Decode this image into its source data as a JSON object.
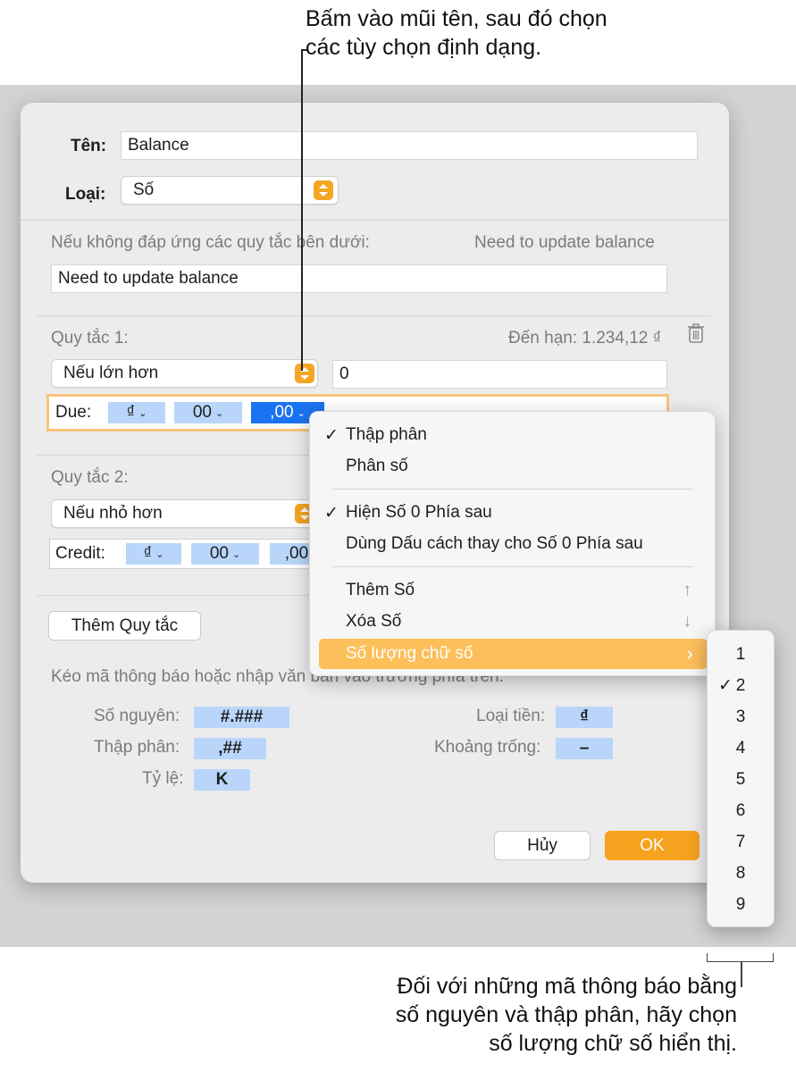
{
  "callouts": {
    "top_line1": "Bấm vào mũi tên, sau đó chọn",
    "top_line2": "các tùy chọn định dạng.",
    "bottom_line1": "Đối với những mã thông báo bằng",
    "bottom_line2": "số nguyên và thập phân, hãy chọn",
    "bottom_line3": "số lượng chữ số hiển thị."
  },
  "dialog": {
    "name_label": "Tên:",
    "name_value": "Balance",
    "type_label": "Loại:",
    "type_value": "Số",
    "fallback_label": "Nếu không đáp ứng các quy tắc bên dưới:",
    "fallback_preview": "Need to update balance",
    "fallback_value": "Need to update balance",
    "rule1": {
      "title": "Quy tắc 1:",
      "preview": "Đến hạn: 1.234,12 ₫",
      "condition": "Nếu lớn hơn",
      "value": "0",
      "format_prefix": "Due:",
      "tokens": [
        "₫",
        "00",
        ",00"
      ]
    },
    "rule2": {
      "title": "Quy tắc 2:",
      "condition": "Nếu nhỏ hơn",
      "format_prefix": "Credit:",
      "tokens": [
        "₫",
        "00",
        ",00"
      ]
    },
    "add_rule": "Thêm Quy tắc",
    "hint": "Kéo mã thông báo hoặc nhập văn bản vào trường phía trên.",
    "token_legend": {
      "integer_label": "Số nguyên:",
      "integer_token": "#.###",
      "decimal_label": "Thập phân:",
      "decimal_token": ",##",
      "scale_label": "Tỷ lệ:",
      "scale_token": "K",
      "currency_label": "Loại tiền:",
      "currency_token": "₫",
      "space_label": "Khoảng trống:",
      "space_token": "–"
    },
    "cancel": "Hủy",
    "ok": "OK"
  },
  "menu": {
    "decimal": "Thập phân",
    "fraction": "Phân số",
    "show_trailing_zeros": "Hiện Số 0 Phía sau",
    "spaces_for_zeros": "Dùng Dấu cách thay cho Số 0 Phía sau",
    "add_digit": "Thêm Số",
    "add_digit_key": "↑",
    "remove_digit": "Xóa Số",
    "remove_digit_key": "↓",
    "digit_count": "Số lượng chữ số",
    "check": "✓",
    "arrow": "›"
  },
  "submenu": {
    "options": [
      "1",
      "2",
      "3",
      "4",
      "5",
      "6",
      "7",
      "8",
      "9"
    ],
    "selected": "2"
  },
  "colors": {
    "accent": "#f6a21e",
    "token": "#b9d6fa",
    "token_selected": "#1a73f0",
    "menu_highlight": "#fcbf5a"
  }
}
